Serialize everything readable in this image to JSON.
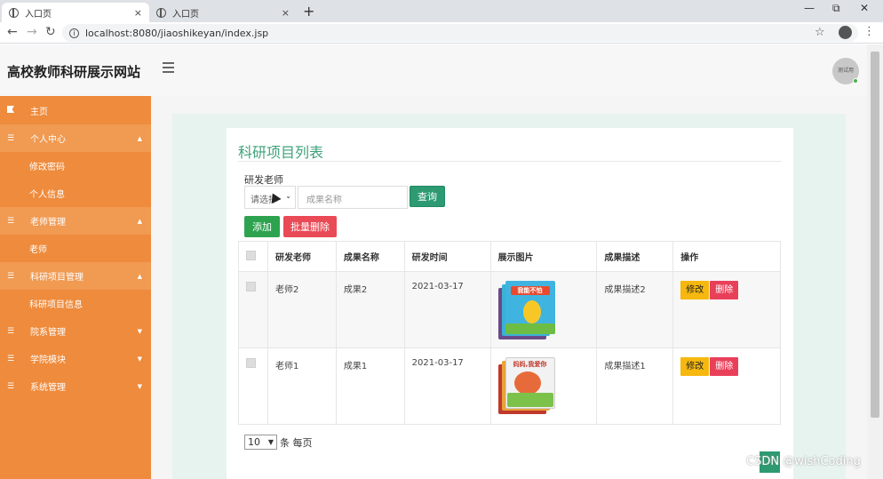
{
  "browser": {
    "tabs": [
      {
        "title": "入口页",
        "close": "×"
      },
      {
        "title": "入口页",
        "close": "×"
      }
    ],
    "new_tab": "+",
    "window_controls": {
      "minimize": "—",
      "restore": "⧉",
      "close": "✕"
    },
    "url": "localhost:8080/jiaoshikeyan/index.jsp"
  },
  "header": {
    "site_title": "高校教师科研展示网站",
    "avatar_text": "测试用"
  },
  "sidebar": {
    "items": [
      {
        "label": "主页",
        "type": "top",
        "icon": "flag-icon"
      },
      {
        "label": "个人中心",
        "type": "group",
        "icon": "list-icon",
        "caret": "▲"
      },
      {
        "label": "修改密码",
        "type": "sub"
      },
      {
        "label": "个人信息",
        "type": "sub"
      },
      {
        "label": "老师管理",
        "type": "group",
        "icon": "list-icon",
        "caret": "▲"
      },
      {
        "label": "老师",
        "type": "sub"
      },
      {
        "label": "科研项目管理",
        "type": "group",
        "icon": "list-icon",
        "caret": "▲"
      },
      {
        "label": "科研项目信息",
        "type": "sub"
      },
      {
        "label": "院系管理",
        "type": "top",
        "icon": "list-icon",
        "caret": "▼"
      },
      {
        "label": "学院模块",
        "type": "top",
        "icon": "list-icon",
        "caret": "▼"
      },
      {
        "label": "系统管理",
        "type": "top",
        "icon": "list-icon",
        "caret": "▼"
      }
    ]
  },
  "main": {
    "card_title": "科研项目列表",
    "filter": {
      "label": "研发老师",
      "select_value": "请选择",
      "input_placeholder": "成果名称",
      "search_button": "查询"
    },
    "actions": {
      "add": "添加",
      "batch_delete": "批量删除"
    },
    "table": {
      "columns": [
        "",
        "研发老师",
        "成果名称",
        "研发时间",
        "展示图片",
        "成果描述",
        "操作"
      ],
      "rows": [
        {
          "teacher": "老师2",
          "name": "成果2",
          "date": "2021-03-17",
          "image_text": "我能不怕",
          "description": "成果描述2",
          "edit": "修改",
          "delete": "删除"
        },
        {
          "teacher": "老师1",
          "name": "成果1",
          "date": "2021-03-17",
          "image_text": "妈妈,我爱你",
          "description": "成果描述1",
          "edit": "修改",
          "delete": "删除"
        }
      ]
    },
    "pagination": {
      "page_size": "10",
      "page_size_label": "条 每页"
    }
  },
  "watermark": "CSDN @wishCoding",
  "colors": {
    "sidebar": "#ee8b3c",
    "accent_green": "#2d9a72",
    "danger": "#e94a55",
    "warning": "#f6b80f"
  }
}
